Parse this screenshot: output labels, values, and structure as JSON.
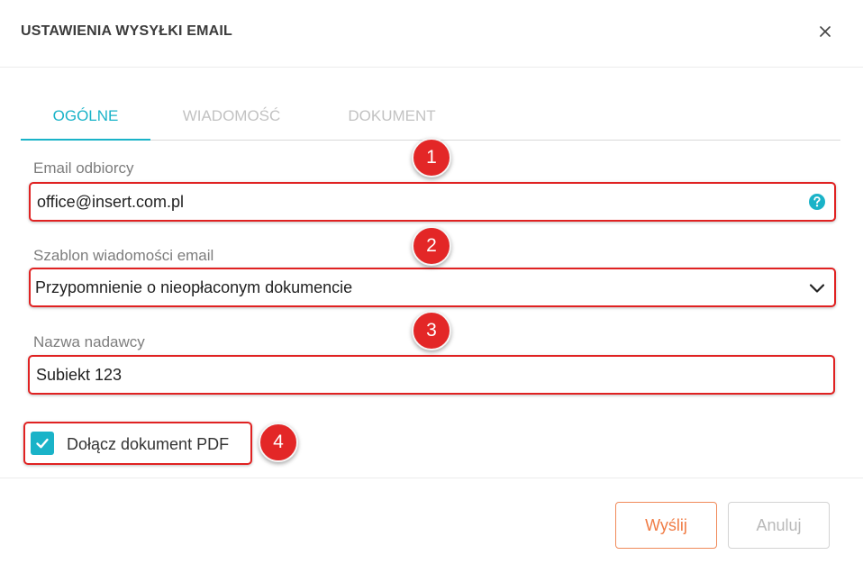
{
  "dialog": {
    "title": "USTAWIENIA WYSYŁKI EMAIL",
    "close_symbol": "×"
  },
  "tabs": [
    {
      "label": "OGÓLNE",
      "active": true
    },
    {
      "label": "WIADOMOŚĆ",
      "active": false
    },
    {
      "label": "DOKUMENT",
      "active": false
    }
  ],
  "form": {
    "recipient_label": "Email odbiorcy",
    "recipient_value": "office@insert.com.pl",
    "template_label": "Szablon wiadomości email",
    "template_value": "Przypomnienie o nieopłaconym dokumencie",
    "sender_label": "Nazwa nadawcy",
    "sender_value": "Subiekt 123",
    "attach_pdf_label": "Dołącz dokument PDF",
    "attach_pdf_checked": true
  },
  "annotations": [
    "1",
    "2",
    "3",
    "4"
  ],
  "buttons": {
    "send": "Wyślij",
    "cancel": "Anuluj"
  },
  "colors": {
    "accent": "#1ab3c8",
    "annotation": "#e32727",
    "send": "#f07c45"
  },
  "icons": {
    "close": "close-icon",
    "help": "help-icon",
    "chevron": "chevron-down-icon",
    "check": "check-icon"
  }
}
